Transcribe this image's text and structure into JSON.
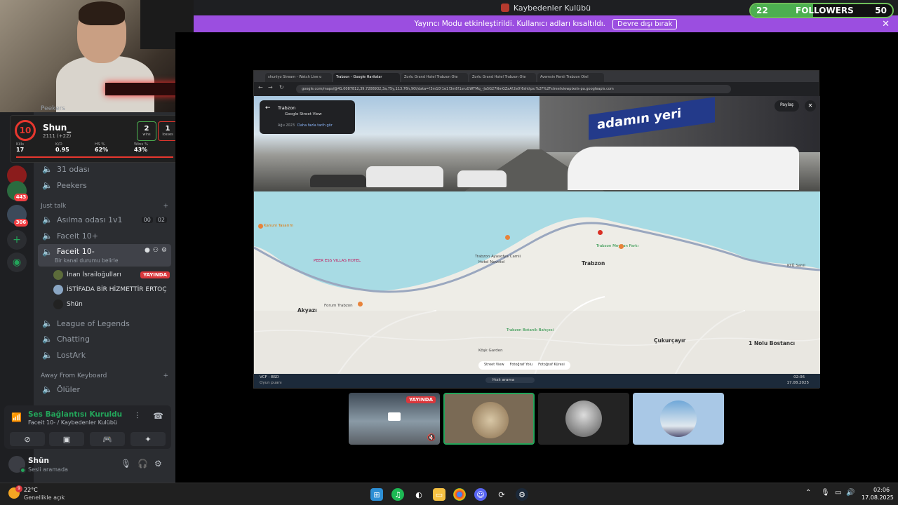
{
  "titlebar": {
    "server_name": "Kaybedenler Kulübü"
  },
  "banner": {
    "message": "Yayıncı Modu etkinleştirildi. Kullanıcı adları kısaltıldı.",
    "button": "Devre dışı bırak"
  },
  "followers": {
    "current": "22",
    "label": "FOLLOWERS",
    "goal": "50",
    "progress": 0.44
  },
  "faceit": {
    "level": "10",
    "name": "Shun_",
    "elo": "2111 (+22)",
    "wins": "2",
    "wins_label": "wins",
    "losses": "1",
    "losses_label": "losses",
    "stats": [
      {
        "label": "Kills",
        "value": "17"
      },
      {
        "label": "K/D",
        "value": "0.95"
      },
      {
        "label": "HS %",
        "value": "62%"
      },
      {
        "label": "Wins %",
        "value": "43%"
      }
    ]
  },
  "rail": {
    "badges": [
      "443",
      "306"
    ]
  },
  "sidebar": {
    "category_top": "Peekers",
    "top_channels": [
      {
        "name": "31 odası"
      },
      {
        "name": "Peekers"
      }
    ],
    "category_just_talk": "Just talk",
    "just_talk": [
      {
        "name": "Asılma odası 1v1",
        "count_a": "00",
        "count_b": "02"
      },
      {
        "name": "Faceit 10+"
      },
      {
        "name": "Faceit 10-",
        "status": "Bir kanal durumu belirle"
      }
    ],
    "voice_users": [
      {
        "name": "İnan İsrailoğulları",
        "live": "YAYINDA"
      },
      {
        "name": "İSTİFADA BİR HİZMETTİR ERTOÇ"
      },
      {
        "name": "Shün"
      }
    ],
    "more_channels": [
      {
        "name": "League of Legends"
      },
      {
        "name": "Chatting"
      },
      {
        "name": "LostArk"
      }
    ],
    "category_afk": "Away From Keyboard",
    "afk_channels": [
      {
        "name": "Ölüler"
      }
    ]
  },
  "voice": {
    "title": "Ses Bağlantısı Kuruldu",
    "subtitle": "Faceit 10- / Kaybedenler Kulübü"
  },
  "user": {
    "name": "Shün",
    "status": "Sesli aramada"
  },
  "browser": {
    "tabs": [
      "shunlyo Stream - Watch Live o",
      "Trabzon - Google Haritalar",
      "Zorlu Grand Hotel Trabzon Ote",
      "Zorlu Grand Hotel Trabzon Ote",
      "Avemsin Renti Trabzon Otel"
    ],
    "address": "google.com/maps/@41.0087812,39.7208932,3a,75y,113.76h,90t/data=!3m10!1e1!3m8!1sruGWTMq_-Ja5G27NmGZaA!2e0!6shttps:%2F%2Fstreetviewpixels-pa.googleapis.com",
    "sv_title": "Trabzon",
    "sv_sub": "Google Street View",
    "sv_date": "Ağu 2023",
    "sv_more": "Daha fazla tarih gör",
    "share": "Paylaş",
    "sign_text": "adamın yeri",
    "map_labels": [
      "Trabzon",
      "Akyazı",
      "Çukurçayır",
      "1 Nolu Bostancı",
      "Trabzon Meydan Parkı",
      "Trabzon Ayasofya Camii",
      "Hotel Novotel",
      "KTÜ Sahil",
      "Forum Trabzon",
      "Trabzon Botanik Bahçesi",
      "Köşk Garden",
      "PEER ESS VILLAS HOTEL",
      "Kanuni Tasarım"
    ],
    "map_legend": [
      "Street View",
      "Fotoğraf Yolu",
      "Fotoğraf Küresi"
    ],
    "taskbar_left": "VCF - BSD",
    "taskbar_sub": "Oyun puanı",
    "search": "Hızlı arama",
    "clock_time": "02:06",
    "clock_date": "17.08.2025"
  },
  "participants": {
    "live": "YAYINDA"
  },
  "taskbar": {
    "weather_temp": "22°C",
    "weather_desc": "Genellikle açık",
    "badge": "9",
    "time": "02:06",
    "date": "17.08.2025"
  },
  "colors": {
    "accent_banner": "#9b4ee0",
    "online": "#23a55a",
    "live": "#da373c",
    "faceit_red": "#e8372e"
  }
}
